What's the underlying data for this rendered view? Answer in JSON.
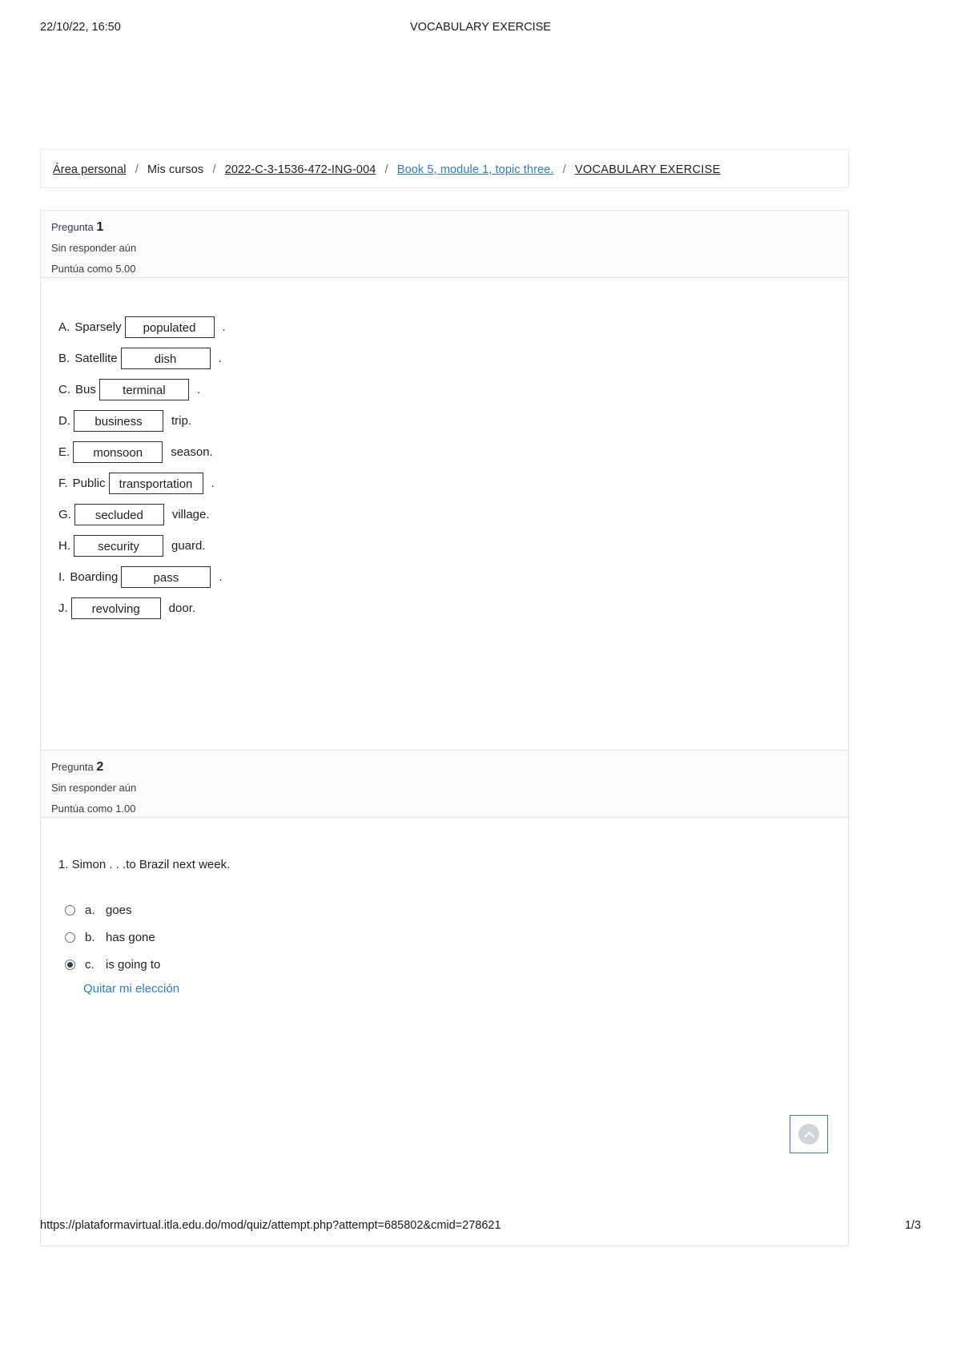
{
  "print_header": {
    "date": "22/10/22, 16:50",
    "title": "VOCABULARY EXERCISE"
  },
  "breadcrumb": {
    "items": [
      {
        "label": "Área personal",
        "style": "underline"
      },
      {
        "label": "Mis cursos",
        "style": "plain"
      },
      {
        "label": "2022-C-3-1536-472-ING-004",
        "style": "underline"
      },
      {
        "label": "Book 5, module 1, topic three.",
        "style": "link"
      },
      {
        "label": "VOCABULARY EXERCISE",
        "style": "current"
      }
    ],
    "separator": "/"
  },
  "questions": [
    {
      "number_label": "Pregunta",
      "number": "1",
      "state": "Sin responder aún",
      "grade": "Puntúa como 5.00",
      "type": "gapfill",
      "rows": [
        {
          "letter": "A.",
          "lead": "Sparsely",
          "value": "populated",
          "tail": ".",
          "width": "w-long"
        },
        {
          "letter": "B.",
          "lead": "Satellite",
          "value": "dish",
          "tail": ".",
          "width": "w-long"
        },
        {
          "letter": "C.",
          "lead": "Bus",
          "value": "terminal",
          "tail": ".",
          "width": "w-long"
        },
        {
          "letter": "D.",
          "lead": "",
          "value": "business",
          "tail": "trip.",
          "width": "w-long"
        },
        {
          "letter": "E.",
          "lead": "",
          "value": "monsoon",
          "tail": "season.",
          "width": "w-long"
        },
        {
          "letter": "F.",
          "lead": "Public",
          "value": "transportation",
          "tail": ".",
          "width": "w-xl"
        },
        {
          "letter": "G.",
          "lead": "",
          "value": "secluded",
          "tail": "village.",
          "width": "w-long"
        },
        {
          "letter": "H.",
          "lead": "",
          "value": "security",
          "tail": "guard.",
          "width": "w-long"
        },
        {
          "letter": "I.",
          "lead": "Boarding",
          "value": "pass",
          "tail": ".",
          "width": "w-long"
        },
        {
          "letter": "J.",
          "lead": "",
          "value": "revolving",
          "tail": "door.",
          "width": "w-long"
        }
      ]
    },
    {
      "number_label": "Pregunta",
      "number": "2",
      "state": "Sin responder aún",
      "grade": "Puntúa como 1.00",
      "type": "multichoice",
      "stem": "1. Simon . . .to Brazil next week.",
      "options": [
        {
          "letter": "a.",
          "text": "goes",
          "selected": false
        },
        {
          "letter": "b.",
          "text": "has gone",
          "selected": false
        },
        {
          "letter": "c.",
          "text": "is going to",
          "selected": true
        }
      ],
      "clear_choice": "Quitar mi elección"
    }
  ],
  "to_top_button": {
    "icon": "chevron-up-icon"
  },
  "print_footer": {
    "url": "https://plataformavirtual.itla.edu.do/mod/quiz/attempt.php?attempt=685802&cmid=278621",
    "page": "1/3"
  },
  "colors": {
    "link": "#2f7cc3",
    "text": "#1d2125",
    "border": "#e2e4e7"
  }
}
